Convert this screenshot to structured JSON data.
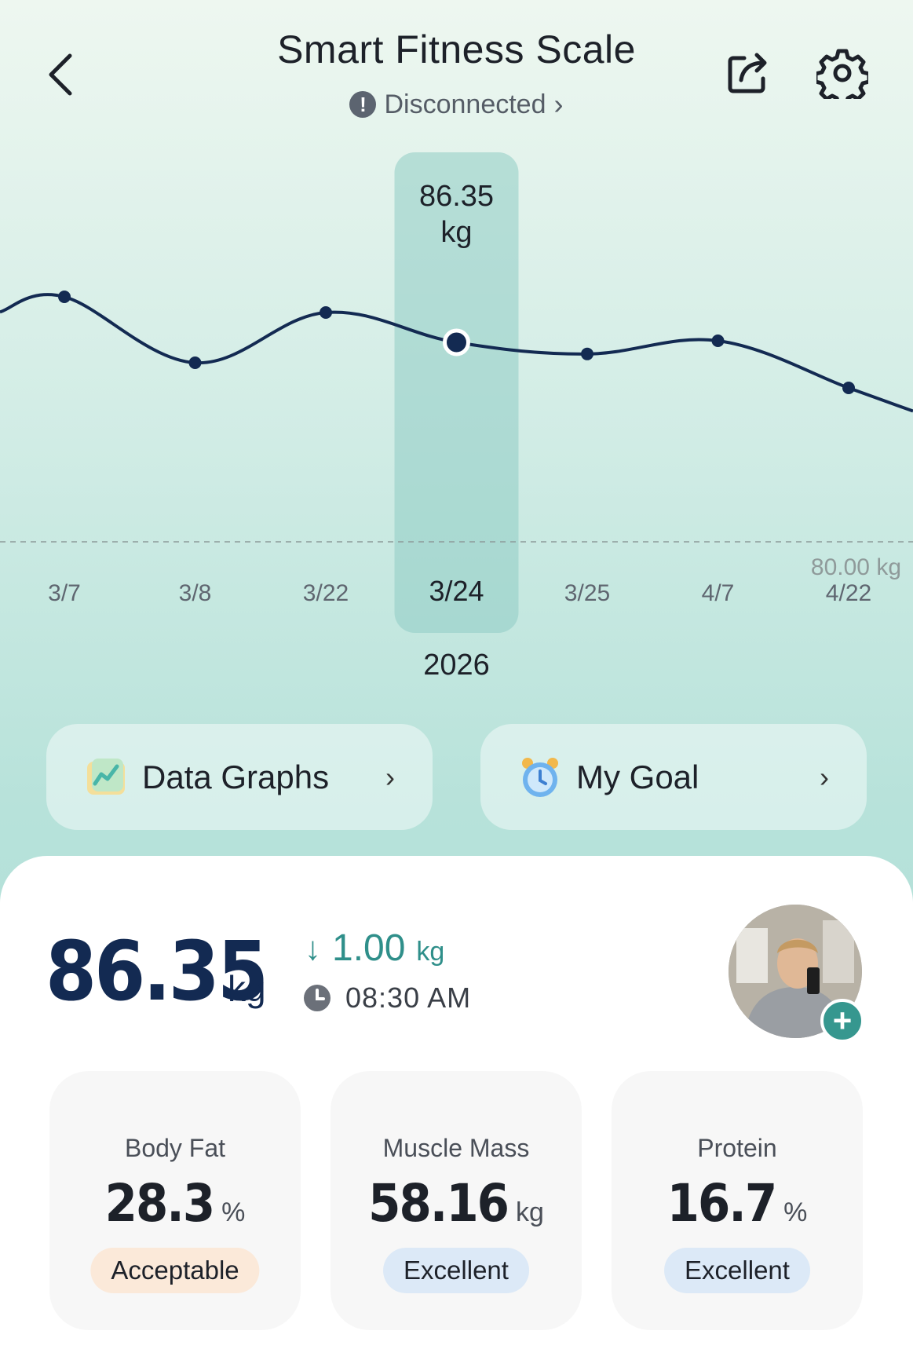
{
  "header": {
    "title": "Smart Fitness Scale",
    "status": "Disconnected",
    "status_chevron": "›"
  },
  "icons": {
    "back": "chevron-left-icon",
    "share": "share-icon",
    "settings": "gear-icon",
    "warning": "exclamation-icon",
    "data_graphs": "chart-icon",
    "my_goal": "alarm-clock-icon",
    "time": "clock-icon",
    "add_photo": "plus-icon"
  },
  "chart_data": {
    "type": "line",
    "x": [
      "3/7",
      "3/8",
      "3/22",
      "3/24",
      "3/25",
      "4/7",
      "4/22"
    ],
    "y": [
      87.8,
      85.7,
      87.3,
      86.35,
      85.98,
      86.4,
      84.9
    ],
    "selected_index": 3,
    "selected_label": [
      "86.35",
      "kg"
    ],
    "reference_label": "80.00 kg",
    "reference_value": 80.0,
    "ylim": [
      74.5,
      92.5
    ],
    "year": "2026",
    "line_color": "#132a52"
  },
  "buttons": {
    "data_graphs": "Data Graphs",
    "my_goal": "My Goal",
    "chevron": "›"
  },
  "summary": {
    "weight": "86.35",
    "weight_unit": "kg",
    "delta_arrow": "↓",
    "delta": "1.00",
    "delta_unit": "kg",
    "time": "08:30 AM"
  },
  "metrics": [
    {
      "label": "Body Fat",
      "value": "28.3",
      "unit": "%",
      "status": "Acceptable",
      "status_color": "#fbe9d9"
    },
    {
      "label": "Muscle Mass",
      "value": "58.16",
      "unit": "kg",
      "status": "Excellent",
      "status_color": "#dce9f7"
    },
    {
      "label": "Protein",
      "value": "16.7",
      "unit": "%",
      "status": "Excellent",
      "status_color": "#dce9f7"
    }
  ],
  "colors": {
    "accent": "#2f8f8a",
    "weight": "#132a52"
  }
}
